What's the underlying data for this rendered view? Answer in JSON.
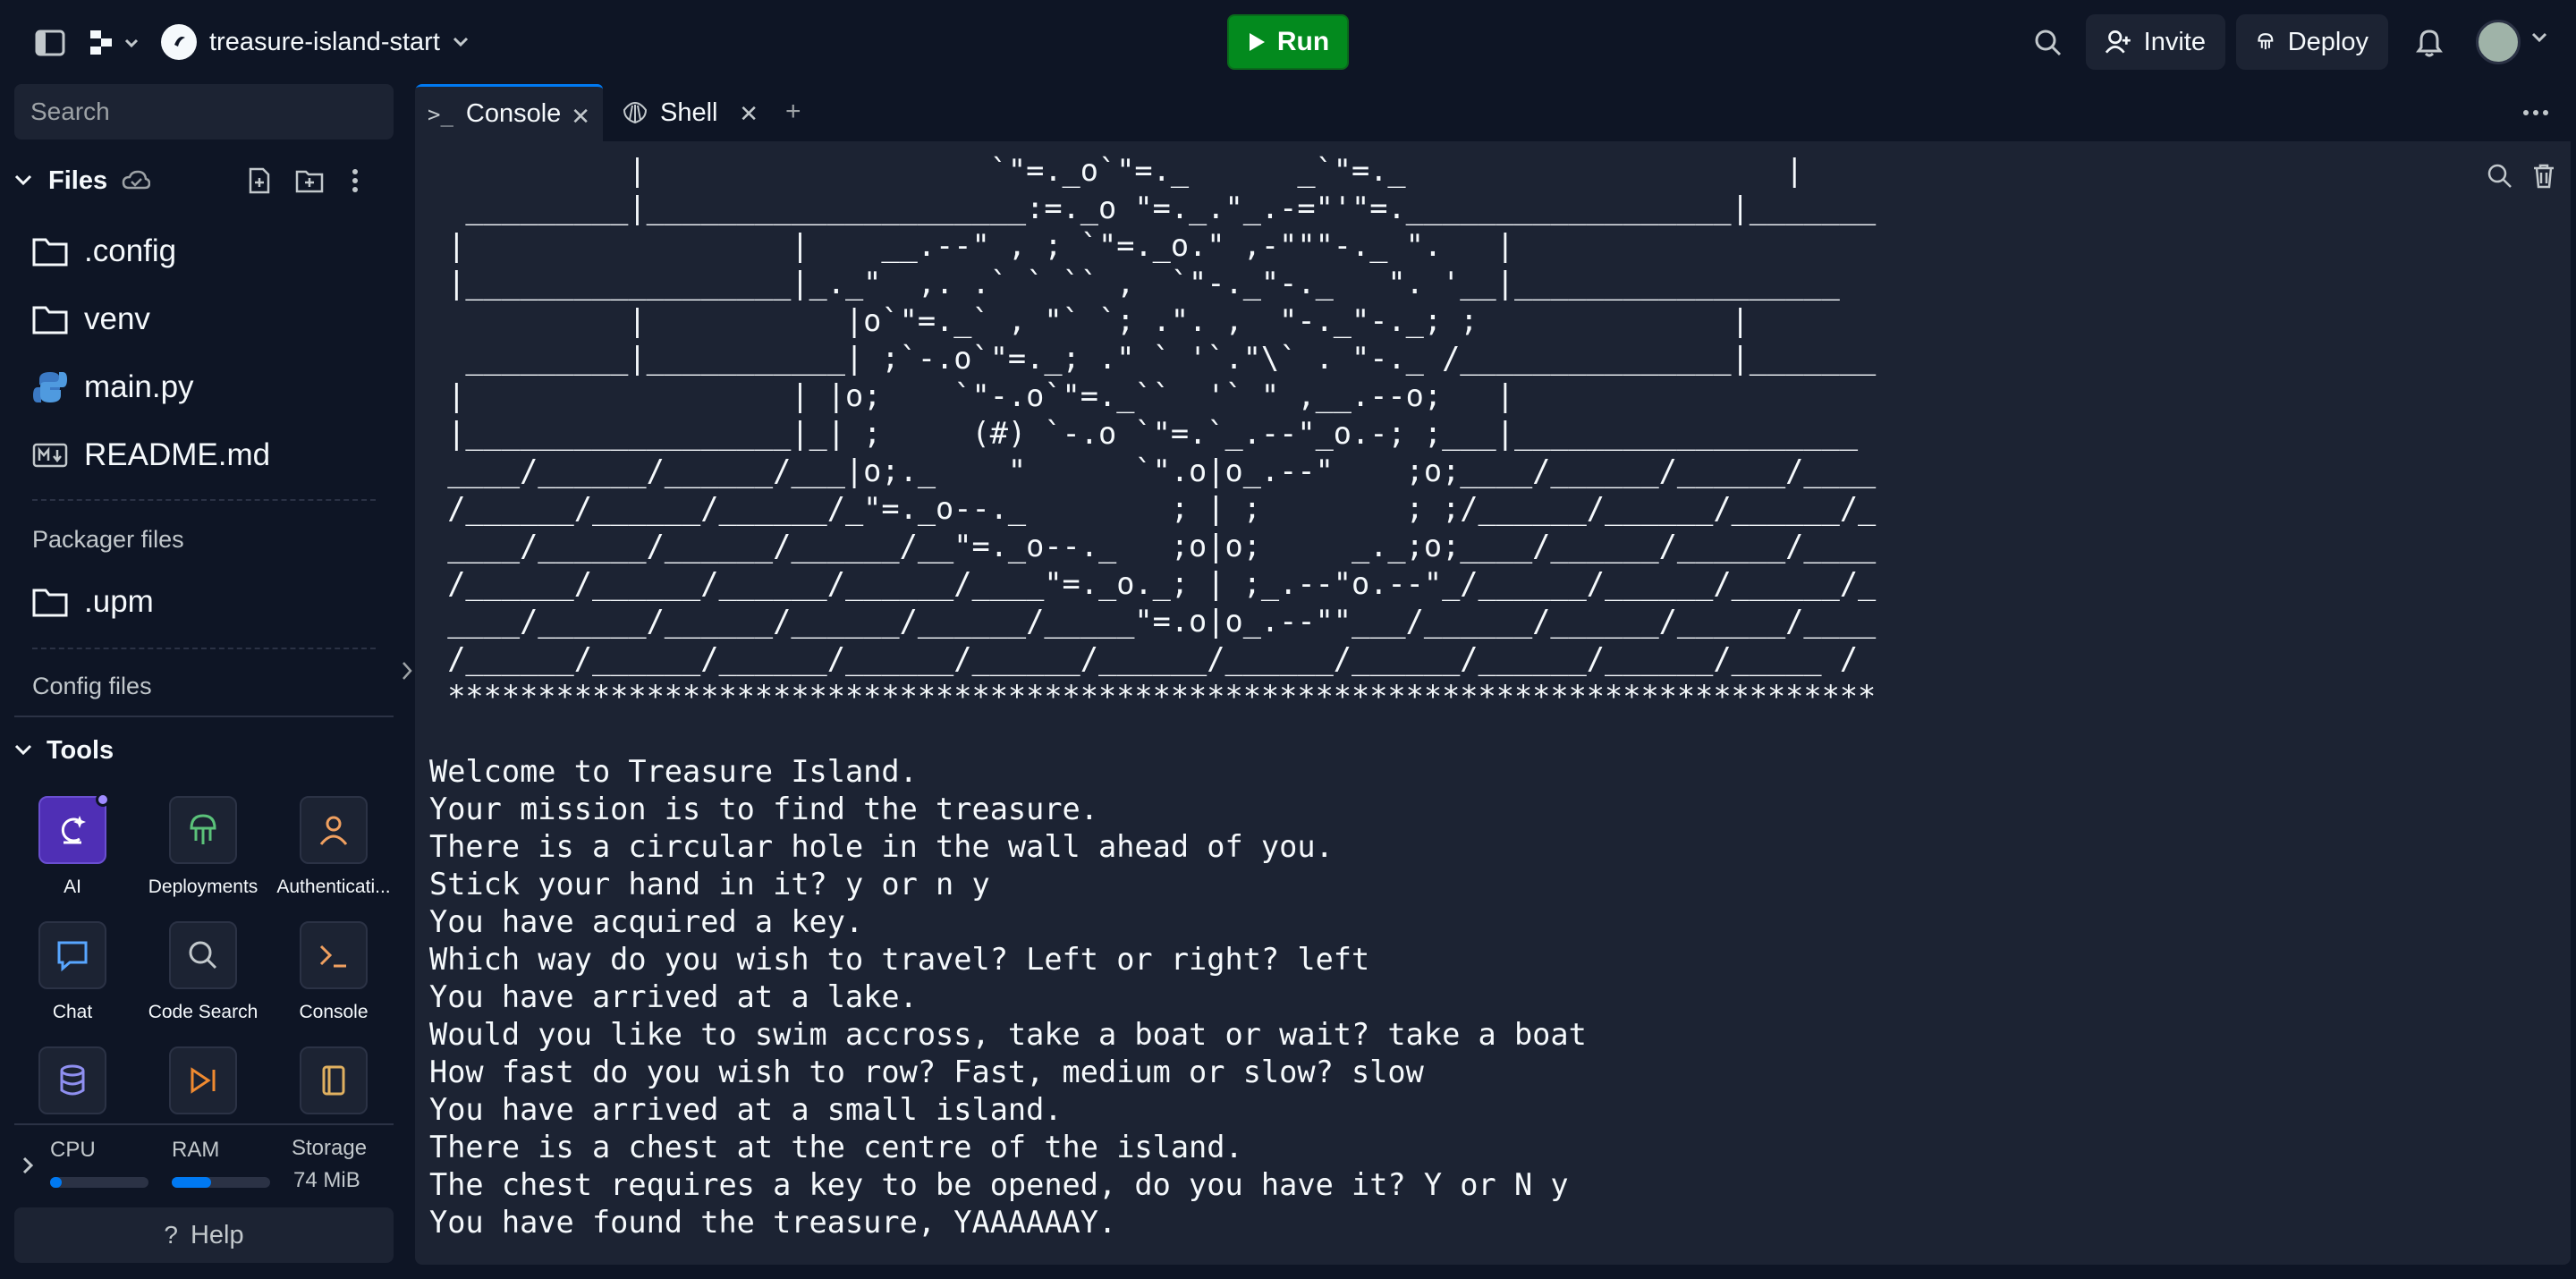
{
  "topbar": {
    "repl_name": "treasure-island-start",
    "run_label": "Run",
    "invite_label": "Invite",
    "deploy_label": "Deploy"
  },
  "sidebar": {
    "search_placeholder": "Search",
    "files_label": "Files",
    "files": [
      {
        "name": ".config",
        "icon": "folder-icon"
      },
      {
        "name": "venv",
        "icon": "folder-icon"
      },
      {
        "name": "main.py",
        "icon": "python-icon"
      },
      {
        "name": "README.md",
        "icon": "markdown-icon"
      }
    ],
    "packager_label": "Packager files",
    "packager_files": [
      {
        "name": ".upm",
        "icon": "folder-icon"
      }
    ],
    "config_label": "Config files",
    "tools_label": "Tools",
    "tools": [
      {
        "label": "AI",
        "icon": "ai-icon"
      },
      {
        "label": "Deployments",
        "icon": "deployments-icon"
      },
      {
        "label": "Authenticati...",
        "icon": "auth-icon"
      },
      {
        "label": "Chat",
        "icon": "chat-icon"
      },
      {
        "label": "Code Search",
        "icon": "search-icon"
      },
      {
        "label": "Console",
        "icon": "console-icon"
      },
      {
        "label": "",
        "icon": "database-icon"
      },
      {
        "label": "",
        "icon": "debugger-icon"
      },
      {
        "label": "",
        "icon": "docs-icon"
      }
    ],
    "resources": {
      "cpu_label": "CPU",
      "ram_label": "RAM",
      "storage_label": "Storage",
      "storage_value": "74 MiB",
      "cpu_fraction": 0.12,
      "ram_fraction": 0.4
    },
    "help_label": "Help"
  },
  "tabs": [
    {
      "label": "Console",
      "icon": "terminal-icon",
      "active": true
    },
    {
      "label": "Shell",
      "icon": "shell-icon",
      "active": false
    }
  ],
  "console": {
    "ascii_art": "           |                   `\"=._o`\"=._      _`\"=._                     |\n  _________|_____________________:=._o \"=._.\"_.-=\"'\"=.__________________|_______\n |                  |    __.--\" , ; `\"=._o.\" ,-\"\"\"-._ \".   |\n |__________________|_._\"  ,. .` ` `` ,  `\"-._\"-._   \". '__|__________________\n           |           |o`\"=._` , \"` `; .\". ,  \"-._\"-._; ;              |\n  _________|___________| ;`-.o`\"=._; .\" ` '`.\"\\` . \"-._ /_______________|_______\n |                  | |o;    `\"-.o`\"=._``  '` \" ,__.--o;   |\n |__________________|_| ;     (#) `-.o `\"=.`_.--\"_o.-; ;___|___________________\n ____/______/______/___|o;._    \"      `\".o|o_.--\"    ;o;____/______/______/____\n /______/______/______/_\"=._o--._        ; | ;        ; ;/______/______/______/_\n ____/______/______/______/__\"=._o--._   ;o|o;     _._;o;____/______/______/____\n /______/______/______/______/____\"=._o._; | ;_.--\"o.--\"_/______/______/______/_\n ____/______/______/______/______/_____\"=.o|o_.--\"\"___/______/______/______/____\n /______/______/______/______/______/______/______/______/______/______/_____ /\n *******************************************************************************",
    "lines": "Welcome to Treasure Island.\nYour mission is to find the treasure.\nThere is a circular hole in the wall ahead of you.\nStick your hand in it? y or n y\nYou have acquired a key.\nWhich way do you wish to travel? Left or right? left\nYou have arrived at a lake.\nWould you like to swim accross, take a boat or wait? take a boat\nHow fast do you wish to row? Fast, medium or slow? slow\nYou have arrived at a small island.\nThere is a chest at the centre of the island.\nThe chest requires a key to be opened, do you have it? Y or N y\nYou have found the treasure, YAAAAAAY."
  }
}
